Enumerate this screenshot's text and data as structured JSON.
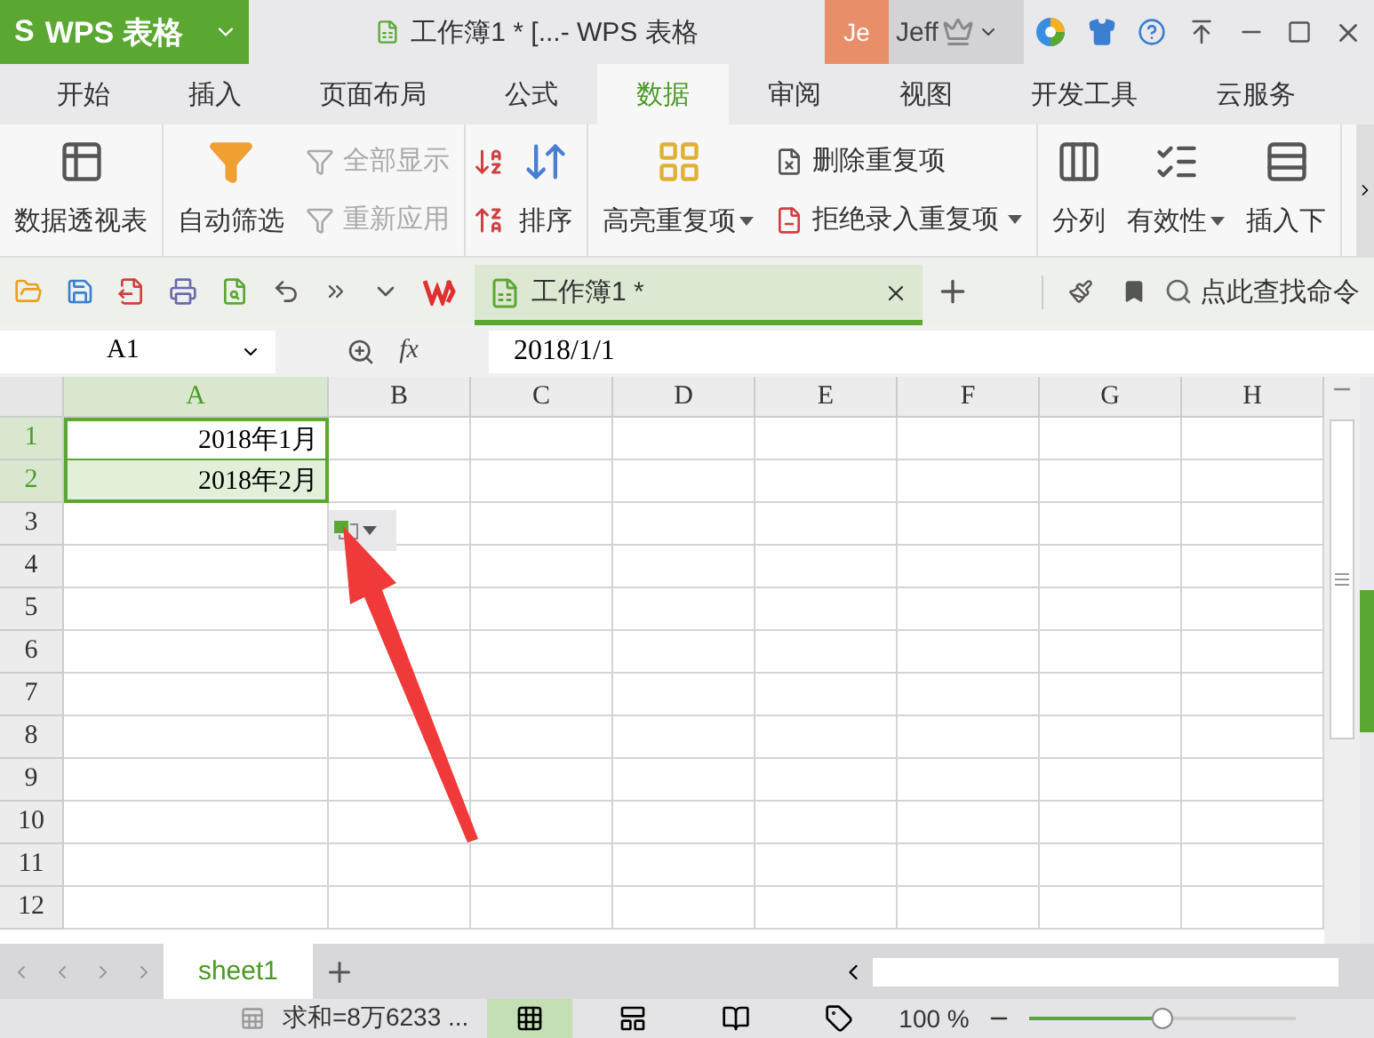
{
  "app": {
    "logo": "S",
    "name": "WPS 表格",
    "title": "工作簿1 * [...- WPS 表格",
    "user_initials": "Je",
    "user_name": "Jeff"
  },
  "tabs": [
    {
      "label": "开始",
      "selected": false
    },
    {
      "label": "插入",
      "selected": false
    },
    {
      "label": "页面布局",
      "selected": false
    },
    {
      "label": "公式",
      "selected": false
    },
    {
      "label": "数据",
      "selected": true
    },
    {
      "label": "审阅",
      "selected": false
    },
    {
      "label": "视图",
      "selected": false
    },
    {
      "label": "开发工具",
      "selected": false
    },
    {
      "label": "云服务",
      "selected": false
    }
  ],
  "ribbon": [
    {
      "items": [
        {
          "kind": "large",
          "label": "数据透视表",
          "dropdown": false,
          "disabled": false
        }
      ]
    },
    {
      "items": [
        {
          "kind": "large",
          "label": "自动筛选",
          "dropdown": false,
          "disabled": false
        },
        {
          "kind": "stack",
          "children": [
            {
              "label": "全部显示",
              "disabled": true,
              "dropdown": false
            },
            {
              "label": "重新应用",
              "disabled": true,
              "dropdown": false
            }
          ]
        }
      ]
    },
    {
      "items": [
        {
          "kind": "sort-icons"
        },
        {
          "kind": "large",
          "label": "排序",
          "dropdown": false,
          "disabled": false
        }
      ]
    },
    {
      "items": [
        {
          "kind": "large",
          "label": "高亮重复项",
          "dropdown": true,
          "disabled": false
        },
        {
          "kind": "stack",
          "children": [
            {
              "label": "删除重复项",
              "disabled": false,
              "dropdown": false
            },
            {
              "label": "拒绝录入重复项",
              "disabled": false,
              "dropdown": true
            }
          ]
        }
      ]
    },
    {
      "items": [
        {
          "kind": "large",
          "label": "分列",
          "dropdown": false,
          "disabled": false
        },
        {
          "kind": "large",
          "label": "有效性",
          "dropdown": true,
          "disabled": false
        },
        {
          "kind": "large",
          "label": "插入下",
          "dropdown": false,
          "disabled": false
        }
      ]
    }
  ],
  "doc_tab": {
    "label": "工作簿1 *",
    "selected": true
  },
  "search": {
    "placeholder": "点此查找命令"
  },
  "name_box": "A1",
  "function_label": "fx",
  "formula": "2018/1/1",
  "columns": [
    {
      "label": "A",
      "selected": true
    },
    {
      "label": "B",
      "selected": false
    },
    {
      "label": "C",
      "selected": false
    },
    {
      "label": "D",
      "selected": false
    },
    {
      "label": "E",
      "selected": false
    },
    {
      "label": "F",
      "selected": false
    },
    {
      "label": "G",
      "selected": false
    },
    {
      "label": "H",
      "selected": false
    }
  ],
  "rows": [
    {
      "label": "1",
      "selected": true,
      "cells": [
        "2018年1月"
      ]
    },
    {
      "label": "2",
      "selected": true,
      "cells": [
        "2018年2月"
      ]
    },
    {
      "label": "3",
      "selected": false,
      "cells": []
    },
    {
      "label": "4",
      "selected": false,
      "cells": []
    },
    {
      "label": "5",
      "selected": false,
      "cells": []
    },
    {
      "label": "6",
      "selected": false,
      "cells": []
    },
    {
      "label": "7",
      "selected": false,
      "cells": []
    },
    {
      "label": "8",
      "selected": false,
      "cells": []
    },
    {
      "label": "9",
      "selected": false,
      "cells": []
    },
    {
      "label": "10",
      "selected": false,
      "cells": []
    },
    {
      "label": "11",
      "selected": false,
      "cells": []
    },
    {
      "label": "12",
      "selected": false,
      "cells": []
    }
  ],
  "sheets": [
    {
      "label": "sheet1",
      "selected": true
    }
  ],
  "status": {
    "sum": "求和=8万6233 ...",
    "views": [
      {
        "selected": true
      },
      {
        "selected": false
      },
      {
        "selected": false
      },
      {
        "selected": false
      }
    ],
    "zoom": "100 %",
    "zoom_slider": {
      "level": 0.5
    }
  }
}
